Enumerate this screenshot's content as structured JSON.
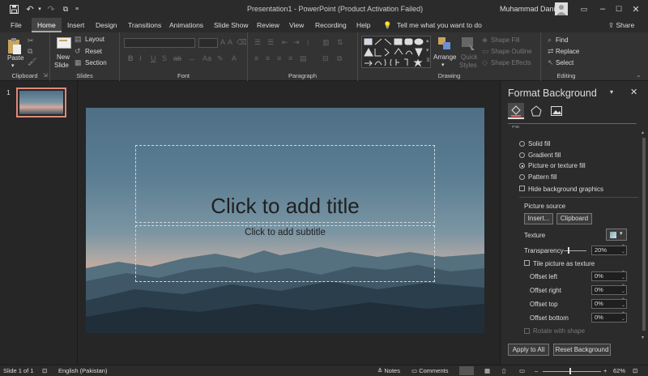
{
  "window": {
    "title": "Presentation1 - PowerPoint (Product Activation Failed)",
    "user": "Muhammad Danial",
    "share": "Share"
  },
  "tabs": [
    "File",
    "Home",
    "Insert",
    "Design",
    "Transitions",
    "Animations",
    "Slide Show",
    "Review",
    "View",
    "Recording",
    "Help"
  ],
  "tell_me": "Tell me what you want to do",
  "ribbon": {
    "clipboard": {
      "paste": "Paste",
      "label": "Clipboard"
    },
    "slides": {
      "new_slide": "New",
      "new_slide2": "Slide",
      "layout": "Layout",
      "reset": "Reset",
      "section": "Section",
      "label": "Slides"
    },
    "font": {
      "label": "Font"
    },
    "paragraph": {
      "label": "Paragraph"
    },
    "drawing": {
      "arrange": "Arrange",
      "quick_styles": "Quick",
      "quick_styles2": "Styles",
      "shape_fill": "Shape Fill",
      "shape_outline": "Shape Outline",
      "shape_effects": "Shape Effects",
      "label": "Drawing"
    },
    "editing": {
      "find": "Find",
      "replace": "Replace",
      "select": "Select",
      "label": "Editing"
    }
  },
  "thumbnail": {
    "number": "1"
  },
  "slide": {
    "title_placeholder": "Click to add title",
    "subtitle_placeholder": "Click to add subtitle"
  },
  "pane": {
    "title": "Format Background",
    "section": "Fill",
    "options": [
      "Solid fill",
      "Gradient fill",
      "Picture or texture fill",
      "Pattern fill"
    ],
    "selected_option": "Picture or texture fill",
    "hide_bg": "Hide background graphics",
    "picture_source": "Picture source",
    "insert": "Insert...",
    "clipboard": "Clipboard",
    "texture": "Texture",
    "transparency": "Transparency",
    "transparency_value": "20%",
    "tile": "Tile picture as texture",
    "offsets": [
      {
        "label": "Offset left",
        "value": "0%"
      },
      {
        "label": "Offset right",
        "value": "0%"
      },
      {
        "label": "Offset top",
        "value": "0%"
      },
      {
        "label": "Offset bottom",
        "value": "0%"
      }
    ],
    "rotate": "Rotate with shape",
    "apply_all": "Apply to All",
    "reset_bg": "Reset Background"
  },
  "status": {
    "slide": "Slide 1 of 1",
    "language": "English (Pakistan)",
    "notes": "Notes",
    "comments": "Comments",
    "zoom": "62%"
  }
}
